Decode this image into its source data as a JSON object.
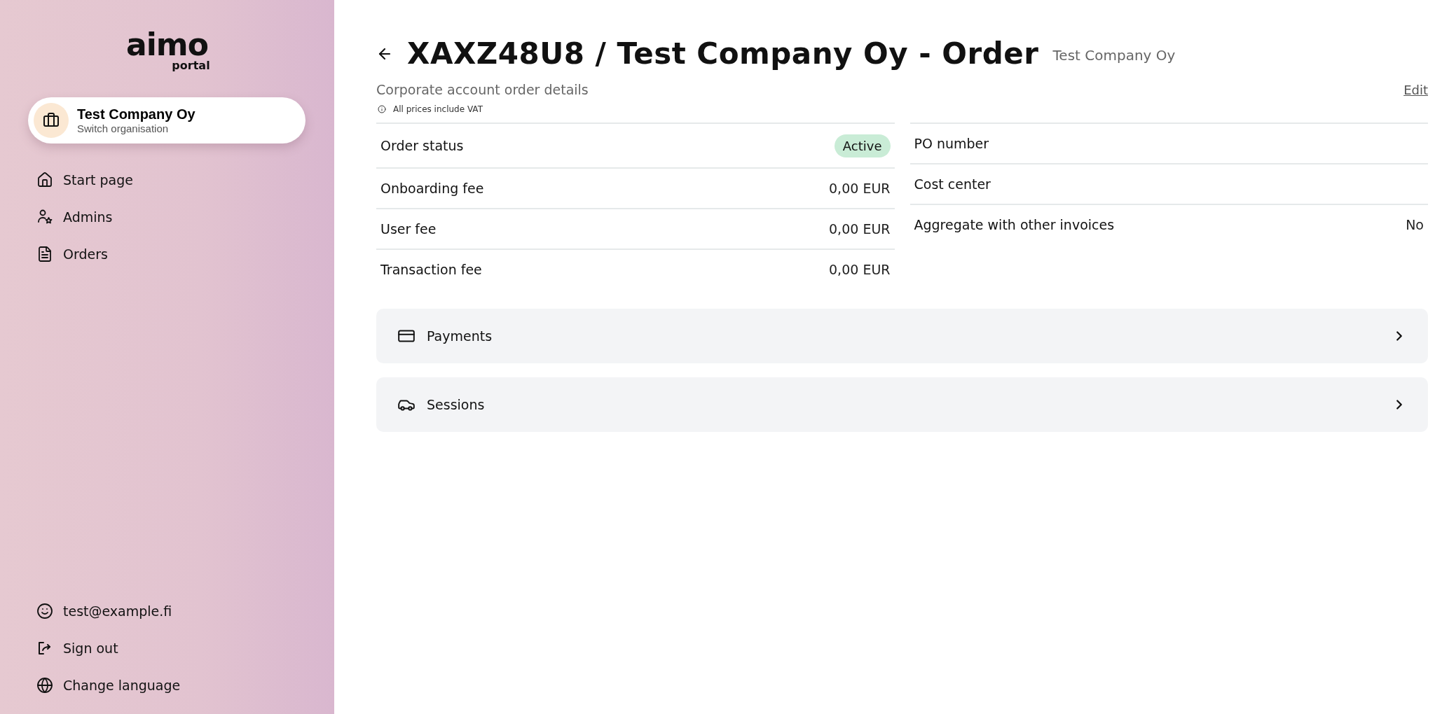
{
  "sidebar": {
    "logo": {
      "wordmark": "aimo",
      "tagline": "portal"
    },
    "organisation": {
      "name": "Test Company Oy",
      "action": "Switch organisation"
    },
    "nav": [
      {
        "kind": "home",
        "label": "Start page"
      },
      {
        "kind": "admins",
        "label": "Admins"
      },
      {
        "kind": "orders",
        "label": "Orders"
      }
    ],
    "footer": [
      {
        "kind": "user",
        "label": "test@example.fi"
      },
      {
        "kind": "signout",
        "label": "Sign out"
      },
      {
        "kind": "language",
        "label": "Change language"
      }
    ]
  },
  "header": {
    "title": "XAXZ48U8 / Test Company Oy - Order",
    "company": "Test Company Oy"
  },
  "subtitle": "Corporate account order details",
  "edit_link": "Edit",
  "vat_note": "All prices include VAT",
  "left_rows": [
    {
      "kind": "status",
      "label": "Order status",
      "value": "Active"
    },
    {
      "kind": "text",
      "label": "Onboarding fee",
      "value": "0,00 EUR"
    },
    {
      "kind": "text",
      "label": "User fee",
      "value": "0,00 EUR"
    },
    {
      "kind": "text",
      "label": "Transaction fee",
      "value": "0,00 EUR"
    }
  ],
  "right_rows": [
    {
      "kind": "text",
      "label": "PO number"
    },
    {
      "kind": "text",
      "label": "Cost center"
    },
    {
      "kind": "text",
      "label": "Aggregate with other invoices",
      "value": "No"
    }
  ],
  "sections": [
    {
      "kind": "payments",
      "label": "Payments"
    },
    {
      "kind": "sessions",
      "label": "Sessions"
    }
  ]
}
